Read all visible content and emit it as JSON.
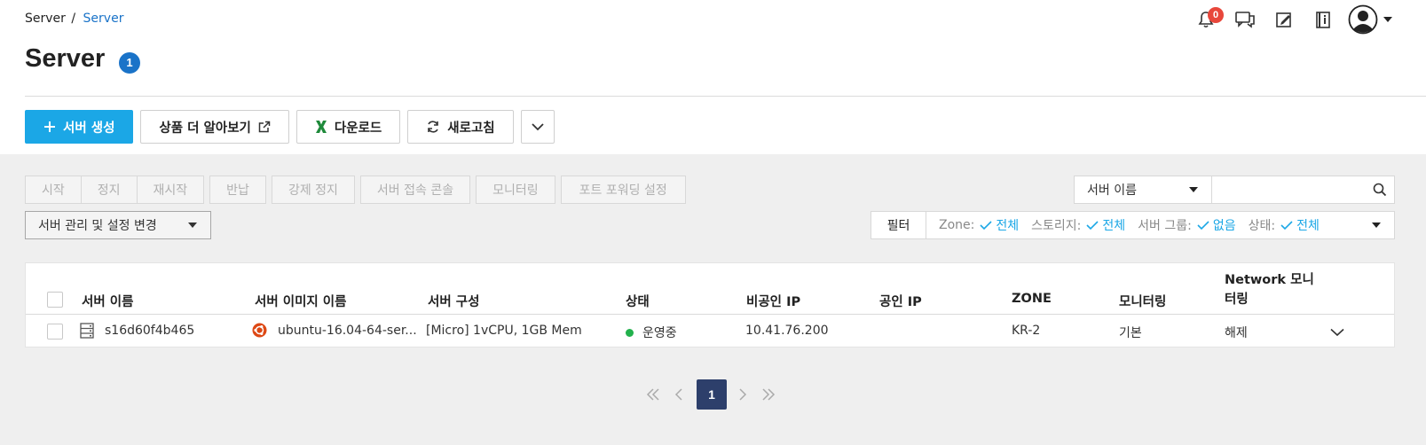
{
  "breadcrumb": {
    "root": "Server",
    "separator": "/",
    "current": "Server"
  },
  "page": {
    "title": "Server",
    "count": "1"
  },
  "header": {
    "notification_count": "0"
  },
  "actions": {
    "create": "서버 생성",
    "learn_more": "상품 더 알아보기",
    "download": "다운로드",
    "refresh": "새로고침"
  },
  "controls": {
    "start": "시작",
    "stop": "정지",
    "restart": "재시작",
    "return": "반납",
    "force_stop": "강제 정지",
    "console": "서버 접속 콘솔",
    "monitoring": "모니터링",
    "port_forwarding": "포트 포워딩 설정",
    "manage": "서버 관리 및 설정 변경"
  },
  "search": {
    "field": "서버 이름",
    "value": ""
  },
  "filter": {
    "label": "필터",
    "items": [
      {
        "key": "Zone:",
        "value": "전체"
      },
      {
        "key": "스토리지:",
        "value": "전체"
      },
      {
        "key": "서버 그룹:",
        "value": "없음"
      },
      {
        "key": "상태:",
        "value": "전체"
      }
    ]
  },
  "table": {
    "headers": {
      "name": "서버 이름",
      "image": "서버 이미지 이름",
      "spec": "서버 구성",
      "status": "상태",
      "private_ip": "비공인 IP",
      "public_ip": "공인 IP",
      "zone": "ZONE",
      "monitoring": "모니터링",
      "network_monitoring": "Network 모니터링"
    },
    "rows": [
      {
        "name": "s16d60f4b465",
        "image": "ubuntu-16.04-64-ser...",
        "spec": "[Micro] 1vCPU, 1GB Mem",
        "status": "운영중",
        "private_ip": "10.41.76.200",
        "public_ip": "",
        "zone": "KR-2",
        "monitoring": "기본",
        "network_monitoring": "해제"
      }
    ]
  },
  "pagination": {
    "current": "1"
  },
  "colors": {
    "primary": "#1ba7e6",
    "link": "#1a73c8",
    "badge": "#e8473b",
    "active_page": "#2d3f6b",
    "running": "#22b14c"
  }
}
